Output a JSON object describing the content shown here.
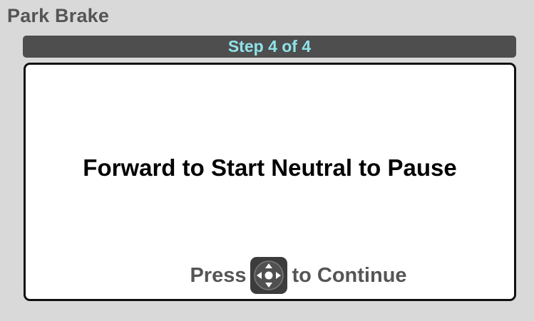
{
  "header": {
    "title": "Park Brake"
  },
  "step_indicator": {
    "label": "Step 4 of 4"
  },
  "panel": {
    "instruction": "Forward to Start Neutral to Pause",
    "continue_prompt": {
      "before": "Press",
      "icon": "dpad-icon",
      "after": "to Continue"
    }
  },
  "colors": {
    "background": "#d9d9d9",
    "title_text": "#555555",
    "step_bar": "#4e4e4e",
    "step_text": "#8fe3ea",
    "panel_bg": "#ffffff",
    "panel_border": "#111111",
    "instruction_text": "#000000",
    "prompt_text": "#555555",
    "dpad_bg": "#3c3c3c"
  }
}
